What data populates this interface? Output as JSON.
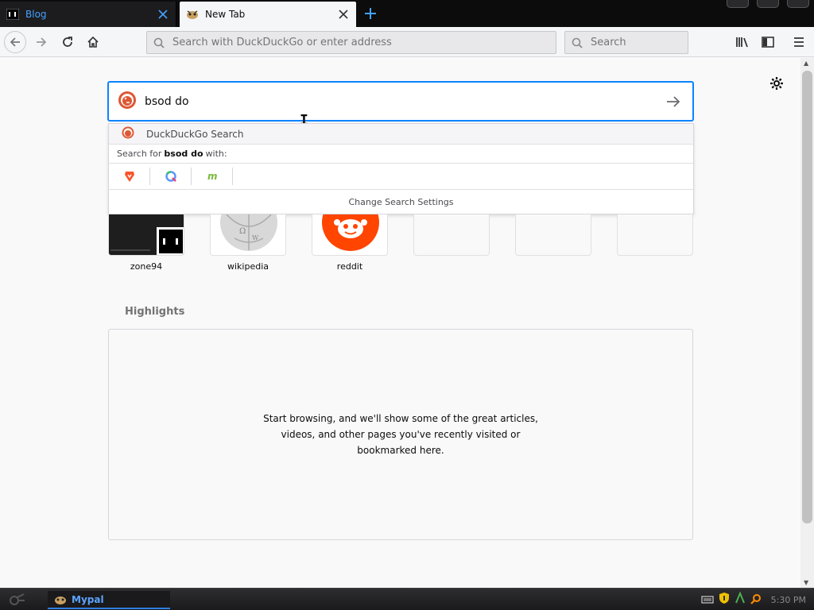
{
  "tabs": [
    {
      "title": "Blog",
      "active": false
    },
    {
      "title": "New Tab",
      "active": true
    }
  ],
  "navbar": {
    "url_placeholder": "Search with DuckDuckGo or enter address",
    "search_placeholder": "Search"
  },
  "search": {
    "query": "bsod do",
    "suggestion": "DuckDuckGo Search",
    "search_for_prefix": "Search for",
    "search_for_term": "bsod do",
    "search_for_suffix": "with:",
    "engines": [
      "brave-icon",
      "qwant-icon",
      "mojeek-icon"
    ],
    "change_settings": "Change Search Settings"
  },
  "top_sites": [
    {
      "label": "zone94",
      "icon": "zone94-thumbnail"
    },
    {
      "label": "wikipedia",
      "icon": "wikipedia-globe-icon"
    },
    {
      "label": "reddit",
      "icon": "reddit-icon"
    },
    {
      "label": "",
      "icon": ""
    },
    {
      "label": "",
      "icon": ""
    },
    {
      "label": "",
      "icon": ""
    }
  ],
  "highlights": {
    "title": "Highlights",
    "message": "Start browsing, and we'll show some of the great articles, videos, and other pages you've recently visited or bookmarked here."
  },
  "taskbar": {
    "app_label": "Mypal",
    "clock": "5:30 PM"
  },
  "colors": {
    "accent": "#0a84ff",
    "tab_link": "#45a1ff",
    "ddg_orange": "#de5833",
    "reddit_orange": "#ff4500"
  }
}
